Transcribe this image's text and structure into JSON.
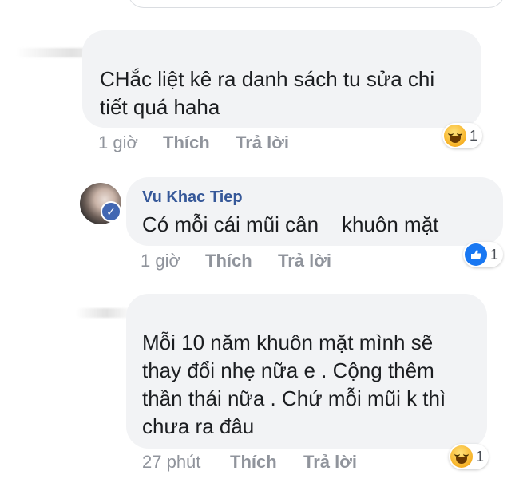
{
  "comments": [
    {
      "text": "CHắc liệt kê ra danh sách tu sửa chi\ntiết quá haha",
      "time": "1 giờ",
      "like_label": "Thích",
      "reply_label": "Trả lời",
      "reaction": {
        "type": "haha",
        "count": "1"
      }
    },
    {
      "author": "Vu Khac Tiep",
      "verified": true,
      "text": "Có mỗi cái mũi cân    khuôn mặt",
      "time": "1 giờ",
      "like_label": "Thích",
      "reply_label": "Trả lời",
      "reaction": {
        "type": "like",
        "count": "1"
      }
    },
    {
      "text": "Mỗi 10 năm khuôn mặt mình sẽ\nthay đổi nhẹ nữa e . Cộng thêm\nthần thái nữa . Chứ mỗi mũi k thì\nchưa ra đâu",
      "time": "27 phút",
      "like_label": "Thích",
      "reply_label": "Trả lời",
      "reaction": {
        "type": "haha",
        "count": "1"
      }
    }
  ],
  "colors": {
    "bubble": "#f2f3f5",
    "name": "#365899",
    "meta": "#90949c",
    "like_blue": "#1877f2"
  }
}
